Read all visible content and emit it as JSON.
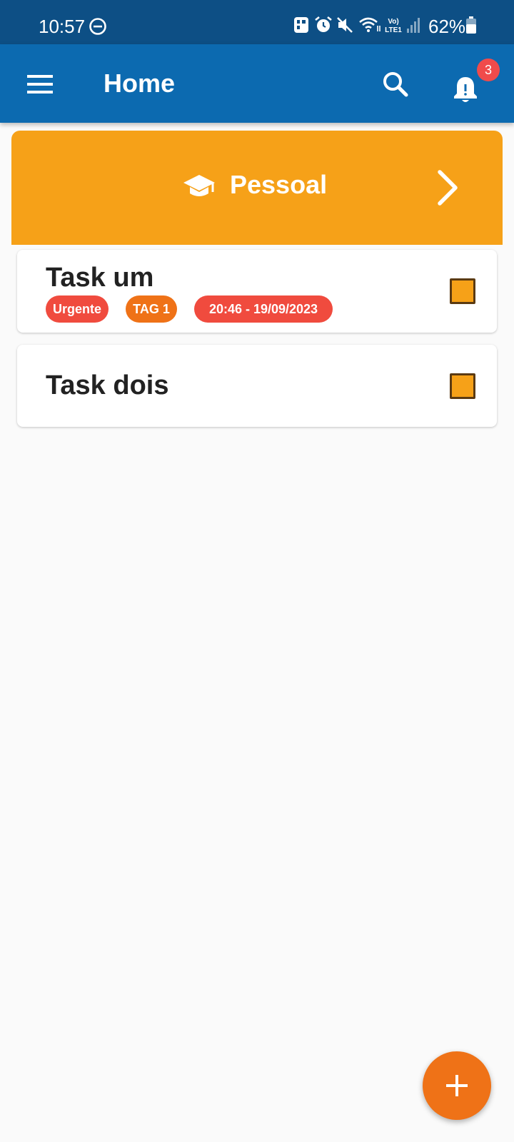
{
  "status_bar": {
    "time": "10:57",
    "battery_percent": "62%",
    "icons": [
      "do-not-disturb-icon",
      "photo-app-icon",
      "alarm-icon",
      "mute-icon",
      "wifi-icon",
      "volte-icon",
      "signal-icon",
      "battery-icon"
    ],
    "network_label": "Vo) LTE1"
  },
  "app_bar": {
    "title": "Home",
    "menu_icon": "menu-icon",
    "search_icon": "search-icon",
    "notification_icon": "bell-icon",
    "notification_count": "3"
  },
  "category": {
    "label": "Pessoal",
    "icon": "graduation-cap-icon",
    "color": "#f6a118"
  },
  "tasks": [
    {
      "title": "Task um",
      "tags": [
        {
          "label": "Urgente",
          "color": "#f04b3e"
        },
        {
          "label": "TAG 1",
          "color": "#ef7217"
        },
        {
          "label": "20:46 - 19/09/2023",
          "color": "#f04b3e"
        }
      ],
      "checked": false
    },
    {
      "title": "Task dois",
      "tags": [],
      "checked": false
    }
  ],
  "fab": {
    "icon": "plus-icon",
    "color": "#ef7217"
  },
  "colors": {
    "status_bar": "#0d4f85",
    "app_bar": "#0c6ab0",
    "background": "#fafafa",
    "badge": "#f04b4b"
  }
}
